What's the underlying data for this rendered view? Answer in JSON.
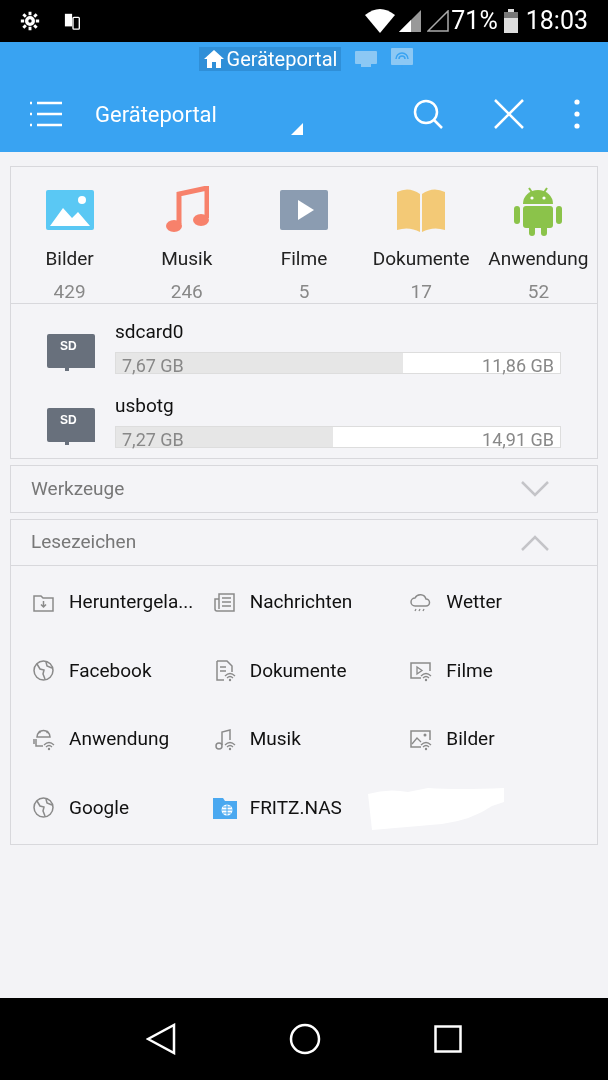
{
  "status_bar": {
    "battery": "71%",
    "time": "18:03"
  },
  "breadcrumb": {
    "label": "Geräteportal",
    "selected": true
  },
  "toolbar": {
    "title": "Geräteportal"
  },
  "categories": [
    {
      "label": "Bilder",
      "count": "429"
    },
    {
      "label": "Musik",
      "count": "246"
    },
    {
      "label": "Filme",
      "count": "5"
    },
    {
      "label": "Dokumente",
      "count": "17"
    },
    {
      "label": "Anwendung",
      "count": "52"
    }
  ],
  "storage": [
    {
      "name": "sdcard0",
      "used": "7,67 GB",
      "total": "11,86 GB",
      "level": 0.647,
      "card_label": "SD"
    },
    {
      "name": "usbotg",
      "used": "7,27 GB",
      "total": "14,91 GB",
      "level": 0.488,
      "card_label": "SD"
    }
  ],
  "sections": [
    {
      "title": "Werkzeuge",
      "expanded": false
    },
    {
      "title": "Lesezeichen",
      "expanded": true
    }
  ],
  "bookmarks": [
    {
      "label": "Heruntergela..."
    },
    {
      "label": "Nachrichten"
    },
    {
      "label": "Wetter"
    },
    {
      "label": "Facebook"
    },
    {
      "label": "Dokumente"
    },
    {
      "label": "Filme"
    },
    {
      "label": "Anwendung"
    },
    {
      "label": "Musik"
    },
    {
      "label": "Bilder"
    },
    {
      "label": "Google"
    },
    {
      "label": "FRITZ.NAS"
    }
  ]
}
